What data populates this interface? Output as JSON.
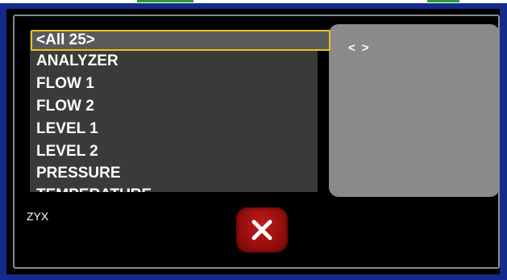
{
  "list": {
    "items": [
      {
        "label": "<All 25>"
      },
      {
        "label": "ANALYZER"
      },
      {
        "label": "FLOW 1"
      },
      {
        "label": "FLOW 2"
      },
      {
        "label": "LEVEL 1"
      },
      {
        "label": "LEVEL 2"
      },
      {
        "label": "PRESSURE"
      },
      {
        "label": "TEMPERATURE"
      }
    ],
    "selected_index": 0
  },
  "side_panel": {
    "nav_label": "< >"
  },
  "footer": {
    "label": "ZYX"
  },
  "icons": {
    "close": "close-x-icon"
  },
  "colors": {
    "frame": "#142a8c",
    "selection_border": "#e8c31a",
    "close_button": "#a81212"
  }
}
